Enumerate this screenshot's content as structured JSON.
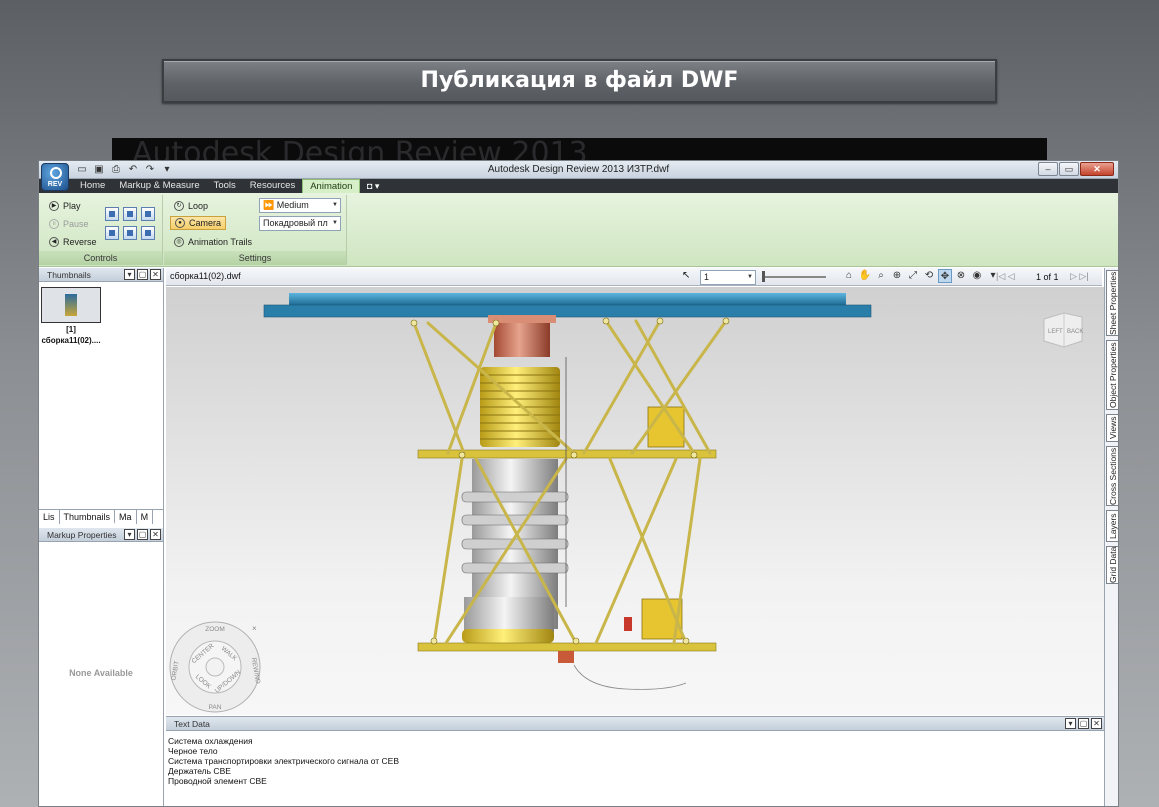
{
  "slide": {
    "title": "Публикация в файл DWF",
    "band_text": "Autodesk Design Review 2013"
  },
  "app": {
    "logo_label": "REV",
    "window_title": "Autodesk Design Review 2013    ИЗТР.dwf",
    "qat_icons": [
      "open-icon",
      "save-icon",
      "print-icon",
      "undo-icon",
      "redo-icon",
      "dropdown-icon"
    ],
    "win_controls": [
      "–",
      "▭",
      "✕"
    ]
  },
  "tabs": [
    "Home",
    "Markup & Measure",
    "Tools",
    "Resources",
    "Animation"
  ],
  "active_tab": "Animation",
  "tab_extra": "◘ ▾",
  "ribbon": {
    "controls": {
      "label": "Controls",
      "play": "Play",
      "pause": "Pause",
      "reverse": "Reverse"
    },
    "settings": {
      "label": "Settings",
      "loop": "Loop",
      "camera": "Camera",
      "animation_trails": "Animation Trails",
      "speed": "Medium",
      "mode": "Покадровый пл"
    }
  },
  "thumbnails_panel": {
    "title": "Thumbnails",
    "thumb_index": "[1]",
    "thumb_name": "сборка11(02)...."
  },
  "panel_tabs": [
    "Lis",
    "Thumbnails",
    "Ma",
    "M"
  ],
  "markup_panel": {
    "title": "Markup Properties",
    "empty": "None Available"
  },
  "doc_toolbar": {
    "doc_name": "сборка11(02).dwf",
    "page_value": "1",
    "page_count": "1 of 1"
  },
  "viewcube": {
    "left": "LEFT",
    "back": "BACK"
  },
  "wheel": {
    "zoom": "ZOOM",
    "orbit": "ORBIT",
    "center": "CENTER",
    "walk": "WALK",
    "rewind": "REWIND",
    "look": "LOOK",
    "up_down": "UP/DOWN",
    "pan": "PAN"
  },
  "right_tabs": [
    "Sheet Properties",
    "Object Properties",
    "Views",
    "Cross Sections",
    "Layers",
    "Grid Data"
  ],
  "text_data": {
    "title": "Text Data",
    "lines": [
      "Система охлаждения",
      "Черное тело",
      "Система транспортировки электрического сигнала от СЕВ",
      "Держатель СВЕ",
      "Проводной элемент СВЕ"
    ]
  },
  "colors": {
    "ribbon_green": "#d6efc9",
    "plate_blue": "#2f86b3",
    "frame_yellow": "#d8c23a",
    "copper": "#c46a4e"
  }
}
